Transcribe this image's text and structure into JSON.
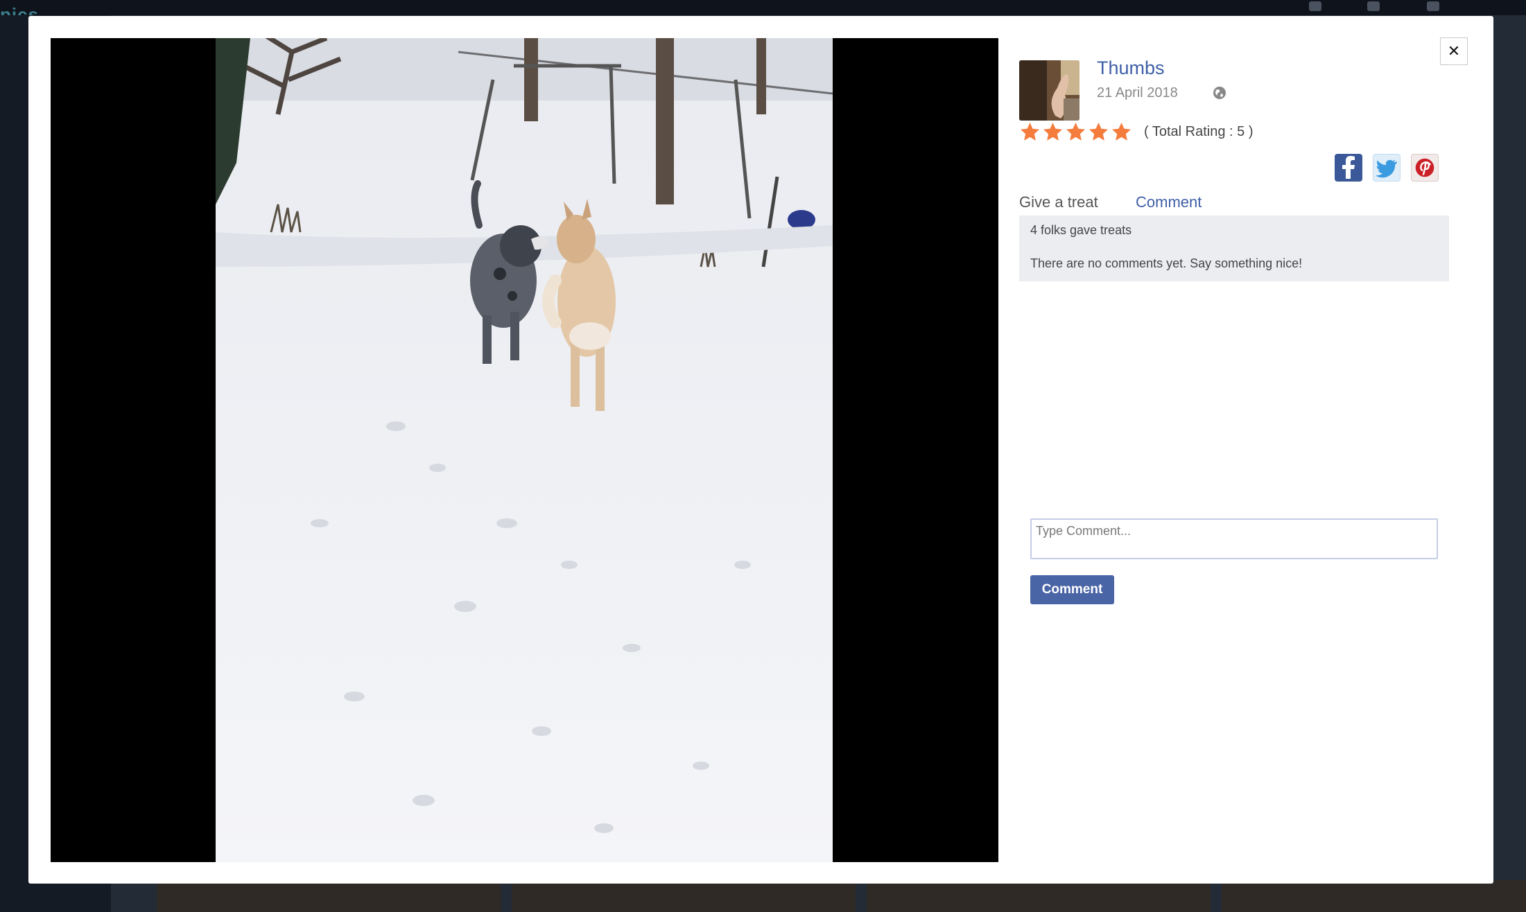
{
  "background": {
    "logo_text": "pics"
  },
  "post": {
    "owner_name": "Thumbs",
    "date": "21 April 2018",
    "rating_stars": 5,
    "total_rating_text": "( Total Rating : 5 )"
  },
  "share": {
    "facebook": "facebook-icon",
    "twitter": "twitter-icon",
    "pinterest": "pinterest-icon"
  },
  "tabs": {
    "give_treat": "Give a treat",
    "comment": "Comment"
  },
  "feedback": {
    "treats_text": "4 folks gave treats",
    "comments_text": "There are no comments yet. Say something nice!"
  },
  "comment_form": {
    "placeholder": "Type Comment...",
    "submit_label": "Comment"
  },
  "close_label": "✕",
  "colors": {
    "link": "#3f5fa8",
    "star": "#f47c3c",
    "button": "#4a65a6"
  }
}
